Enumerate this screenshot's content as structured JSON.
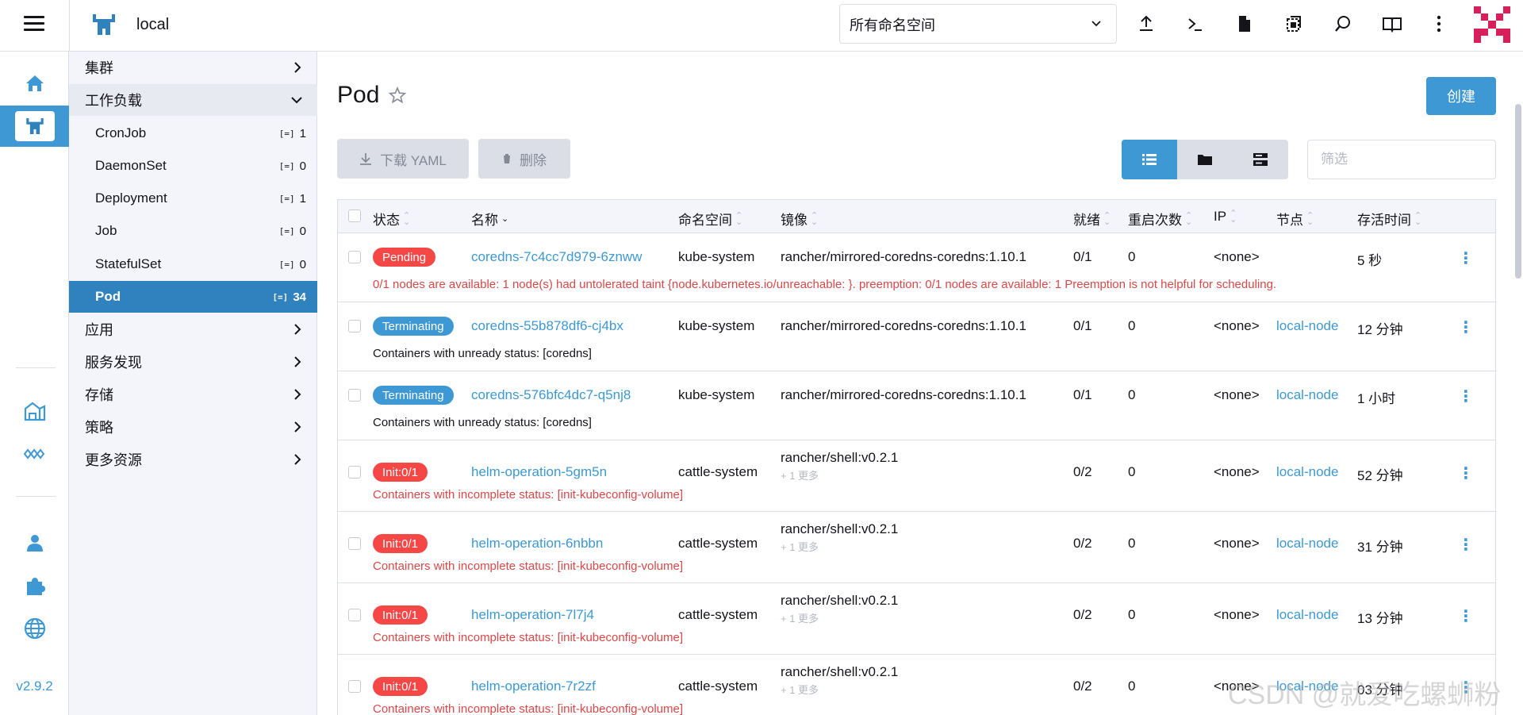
{
  "header": {
    "cluster_name": "local",
    "namespace_select": "所有命名空间"
  },
  "rail": {
    "version": "v2.9.2"
  },
  "sidenav": {
    "groups": [
      {
        "label": "集群"
      },
      {
        "label": "工作负载"
      },
      {
        "label": "应用"
      },
      {
        "label": "服务发现"
      },
      {
        "label": "存储"
      },
      {
        "label": "策略"
      },
      {
        "label": "更多资源"
      }
    ],
    "items": [
      {
        "label": "CronJob",
        "count": "1"
      },
      {
        "label": "DaemonSet",
        "count": "0"
      },
      {
        "label": "Deployment",
        "count": "1"
      },
      {
        "label": "Job",
        "count": "0"
      },
      {
        "label": "StatefulSet",
        "count": "0"
      },
      {
        "label": "Pod",
        "count": "34"
      }
    ]
  },
  "page": {
    "title": "Pod",
    "create_label": "创建",
    "download_yaml_label": "下载 YAML",
    "delete_label": "删除",
    "filter_placeholder": "筛选"
  },
  "table": {
    "headers": [
      "状态",
      "名称",
      "命名空间",
      "镜像",
      "就绪",
      "重启次数",
      "IP",
      "节点",
      "存活时间"
    ],
    "rows": [
      {
        "status": "Pending",
        "status_color": "red",
        "name": "coredns-7c4cc7d979-6znww",
        "namespace": "kube-system",
        "image": "rancher/mirrored-coredns-coredns:1.10.1",
        "image_more": "",
        "ready": "0/1",
        "restarts": "0",
        "ip": "<none>",
        "node": "",
        "age": "5 秒",
        "message": "0/1 nodes are available: 1 node(s) had untolerated taint {node.kubernetes.io/unreachable: }. preemption: 0/1 nodes are available: 1 Preemption is not helpful for scheduling.",
        "message_type": "err"
      },
      {
        "status": "Terminating",
        "status_color": "blue",
        "name": "coredns-55b878df6-cj4bx",
        "namespace": "kube-system",
        "image": "rancher/mirrored-coredns-coredns:1.10.1",
        "image_more": "",
        "ready": "0/1",
        "restarts": "0",
        "ip": "<none>",
        "node": "local-node",
        "age": "12 分钟",
        "message": "Containers with unready status: [coredns]",
        "message_type": "info"
      },
      {
        "status": "Terminating",
        "status_color": "blue",
        "name": "coredns-576bfc4dc7-q5nj8",
        "namespace": "kube-system",
        "image": "rancher/mirrored-coredns-coredns:1.10.1",
        "image_more": "",
        "ready": "0/1",
        "restarts": "0",
        "ip": "<none>",
        "node": "local-node",
        "age": "1 小时",
        "message": "Containers with unready status: [coredns]",
        "message_type": "info"
      },
      {
        "status": "Init:0/1",
        "status_color": "red",
        "name": "helm-operation-5gm5n",
        "namespace": "cattle-system",
        "image": "rancher/shell:v0.2.1",
        "image_more": "+ 1 更多",
        "ready": "0/2",
        "restarts": "0",
        "ip": "<none>",
        "node": "local-node",
        "age": "52 分钟",
        "message": "Containers with incomplete status: [init-kubeconfig-volume]",
        "message_type": "err"
      },
      {
        "status": "Init:0/1",
        "status_color": "red",
        "name": "helm-operation-6nbbn",
        "namespace": "cattle-system",
        "image": "rancher/shell:v0.2.1",
        "image_more": "+ 1 更多",
        "ready": "0/2",
        "restarts": "0",
        "ip": "<none>",
        "node": "local-node",
        "age": "31 分钟",
        "message": "Containers with incomplete status: [init-kubeconfig-volume]",
        "message_type": "err"
      },
      {
        "status": "Init:0/1",
        "status_color": "red",
        "name": "helm-operation-7l7j4",
        "namespace": "cattle-system",
        "image": "rancher/shell:v0.2.1",
        "image_more": "+ 1 更多",
        "ready": "0/2",
        "restarts": "0",
        "ip": "<none>",
        "node": "local-node",
        "age": "13 分钟",
        "message": "Containers with incomplete status: [init-kubeconfig-volume]",
        "message_type": "err"
      },
      {
        "status": "Init:0/1",
        "status_color": "red",
        "name": "helm-operation-7r2zf",
        "namespace": "cattle-system",
        "image": "rancher/shell:v0.2.1",
        "image_more": "+ 1 更多",
        "ready": "0/2",
        "restarts": "0",
        "ip": "<none>",
        "node": "local-node",
        "age": "03 分钟",
        "message": "Containers with incomplete status: [init-kubeconfig-volume]",
        "message_type": "err"
      }
    ]
  },
  "watermark": "CSDN @就爱吃螺蛳粉",
  "colors": {
    "accent": "#3d98d3",
    "active_nav": "#2f82be",
    "danger": "#f64747",
    "border": "#dcdee7"
  }
}
